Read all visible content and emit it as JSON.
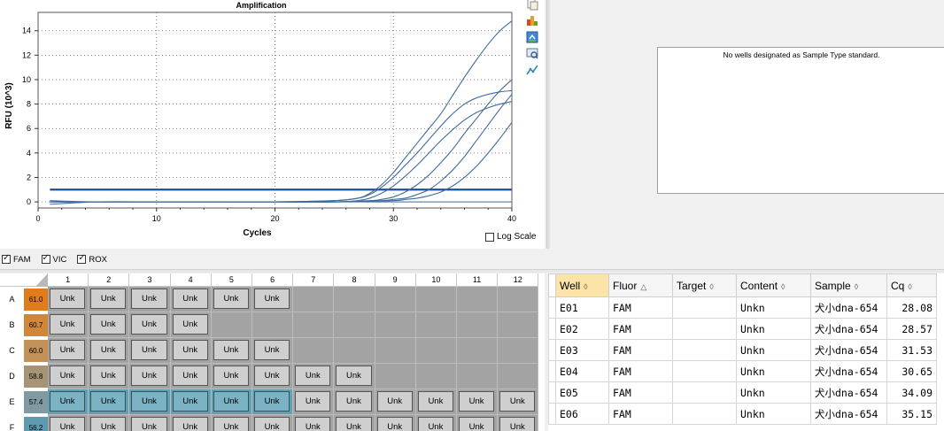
{
  "chart": {
    "title": "Amplification",
    "log_scale_label": "Log Scale"
  },
  "chart_data": {
    "type": "line",
    "title": "Amplification",
    "xlabel": "Cycles",
    "ylabel": "RFU (10^3)",
    "xlim": [
      0,
      40
    ],
    "ylim": [
      -0.5,
      15.5
    ],
    "xticks": [
      0,
      10,
      20,
      30,
      40
    ],
    "yticks": [
      0,
      2,
      4,
      6,
      8,
      10,
      12,
      14
    ],
    "grid": true,
    "threshold": 1.0,
    "series": [
      {
        "x": [
          1,
          5,
          10,
          15,
          20,
          25,
          27,
          28,
          29,
          30,
          31,
          32,
          33,
          34,
          35,
          36,
          37,
          38,
          39,
          40
        ],
        "values": [
          0.1,
          0,
          0,
          0,
          0,
          0.1,
          0.3,
          0.7,
          1.4,
          2.4,
          3.6,
          4.8,
          6.0,
          7.2,
          8.7,
          10.2,
          11.6,
          12.9,
          14.0,
          14.8
        ]
      },
      {
        "x": [
          1,
          5,
          10,
          15,
          20,
          25,
          27,
          28,
          29,
          30,
          31,
          32,
          33,
          34,
          35,
          36,
          37,
          38,
          39,
          40
        ],
        "values": [
          -0.2,
          0,
          0,
          0,
          0,
          0.1,
          0.3,
          0.6,
          1.2,
          2.0,
          3.0,
          4.0,
          5.1,
          6.2,
          7.2,
          8.0,
          8.5,
          8.8,
          9.0,
          9.1
        ]
      },
      {
        "x": [
          1,
          5,
          10,
          15,
          20,
          25,
          27,
          28,
          29,
          30,
          31,
          32,
          33,
          34,
          35,
          36,
          37,
          38,
          39,
          40
        ],
        "values": [
          0,
          0,
          0,
          0,
          0,
          0,
          0.1,
          0.3,
          0.7,
          1.3,
          2.1,
          3.0,
          4.0,
          5.0,
          5.9,
          6.7,
          7.3,
          7.7,
          8.0,
          8.2
        ]
      },
      {
        "x": [
          1,
          5,
          10,
          15,
          20,
          25,
          28,
          29,
          30,
          31,
          32,
          33,
          34,
          35,
          36,
          37,
          38,
          39,
          40
        ],
        "values": [
          0,
          0,
          0,
          0,
          0,
          0,
          0.1,
          0.2,
          0.4,
          0.8,
          1.4,
          2.2,
          3.2,
          4.3,
          5.6,
          6.8,
          8.0,
          9.1,
          10.0
        ]
      },
      {
        "x": [
          1,
          5,
          10,
          15,
          20,
          25,
          29,
          30,
          31,
          32,
          33,
          34,
          35,
          36,
          37,
          38,
          39,
          40
        ],
        "values": [
          0,
          0,
          0,
          0,
          0,
          0,
          0.1,
          0.2,
          0.3,
          0.6,
          1.0,
          1.7,
          2.6,
          3.7,
          5.0,
          6.3,
          7.6,
          8.8
        ]
      },
      {
        "x": [
          1,
          5,
          10,
          15,
          20,
          25,
          30,
          31,
          32,
          33,
          34,
          35,
          36,
          37,
          38,
          39,
          40
        ],
        "values": [
          0,
          0,
          0,
          0,
          0,
          0,
          0.1,
          0.2,
          0.3,
          0.5,
          0.8,
          1.3,
          2.0,
          2.9,
          4.0,
          5.2,
          6.5
        ]
      }
    ]
  },
  "fluors": [
    {
      "label": "FAM",
      "checked": true
    },
    {
      "label": "VIC",
      "checked": true
    },
    {
      "label": "ROX",
      "checked": true
    }
  ],
  "standard_panel": {
    "message": "No wells designated as Sample Type standard."
  },
  "plate": {
    "columns": [
      "1",
      "2",
      "3",
      "4",
      "5",
      "6",
      "7",
      "8",
      "9",
      "10",
      "11",
      "12"
    ],
    "rows": [
      {
        "label": "A",
        "temp": "61.0",
        "temp_color": "#e07c1a",
        "filled": 6,
        "selected": false
      },
      {
        "label": "B",
        "temp": "60.7",
        "temp_color": "#d2863a",
        "filled": 4,
        "selected": false
      },
      {
        "label": "C",
        "temp": "60.0",
        "temp_color": "#c29258",
        "filled": 6,
        "selected": false
      },
      {
        "label": "D",
        "temp": "58.8",
        "temp_color": "#a59476",
        "filled": 8,
        "selected": false
      },
      {
        "label": "E",
        "temp": "57.4",
        "temp_color": "#7f9aa0",
        "filled": 12,
        "selected": true,
        "selected_count": 6
      },
      {
        "label": "F",
        "temp": "56.2",
        "temp_color": "#5e9bb0",
        "filled": 12,
        "selected": false
      }
    ],
    "well_label": "Unk"
  },
  "table": {
    "headers": [
      {
        "label": "Well",
        "sort": "◊",
        "sorted": true
      },
      {
        "label": "Fluor",
        "sort": "△",
        "sorted": false
      },
      {
        "label": "Target",
        "sort": "◊",
        "sorted": false
      },
      {
        "label": "Content",
        "sort": "◊",
        "sorted": false
      },
      {
        "label": "Sample",
        "sort": "◊",
        "sorted": false
      },
      {
        "label": "Cq",
        "sort": "◊",
        "sorted": false
      }
    ],
    "rows": [
      [
        "E01",
        "FAM",
        "",
        "Unkn",
        "犬小dna-654",
        "28.08"
      ],
      [
        "E02",
        "FAM",
        "",
        "Unkn",
        "犬小dna-654",
        "28.57"
      ],
      [
        "E03",
        "FAM",
        "",
        "Unkn",
        "犬小dna-654",
        "31.53"
      ],
      [
        "E04",
        "FAM",
        "",
        "Unkn",
        "犬小dna-654",
        "30.65"
      ],
      [
        "E05",
        "FAM",
        "",
        "Unkn",
        "犬小dna-654",
        "34.09"
      ],
      [
        "E06",
        "FAM",
        "",
        "Unkn",
        "犬小dna-654",
        "35.15"
      ]
    ]
  },
  "colors": {
    "curve": "#3f6c9e",
    "threshold": "#1d4f8f",
    "well_empty": "#a3a3a3",
    "well_selected": "#5fa0b4",
    "sorted_header": "#fce3a8"
  }
}
